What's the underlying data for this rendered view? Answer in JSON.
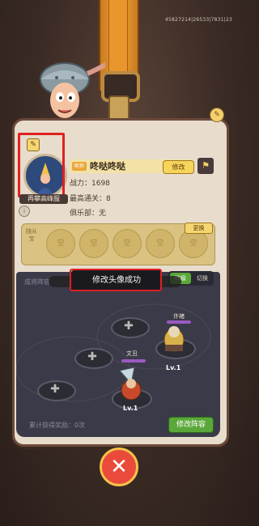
{
  "header": {
    "id_line": "45827214|26533|7831|23"
  },
  "profile": {
    "avatar_caption": "再攀高峰服",
    "name_tag": "昵称",
    "name": "咚哒咚哒",
    "modify_label": "修改",
    "power": "战力：1698",
    "highest_level": "最高通关：8",
    "club": "俱乐部：无"
  },
  "pets": {
    "label": "随从宝",
    "slots": [
      "空",
      "空",
      "空",
      "空",
      "空"
    ],
    "change_label": "更换"
  },
  "lineup": {
    "title": "成将阵容",
    "tab_active": "阵级",
    "tab_inactive": "切换",
    "heroes": [
      {
        "name": "许褚",
        "level": "Lv.1"
      },
      {
        "name": "文丑",
        "level": "Lv.1"
      }
    ],
    "cumulative": "累计获得奖励：0次",
    "save_label": "修改阵容"
  },
  "toast": {
    "message": "修改头像成功"
  },
  "close": {
    "label": "✕"
  }
}
